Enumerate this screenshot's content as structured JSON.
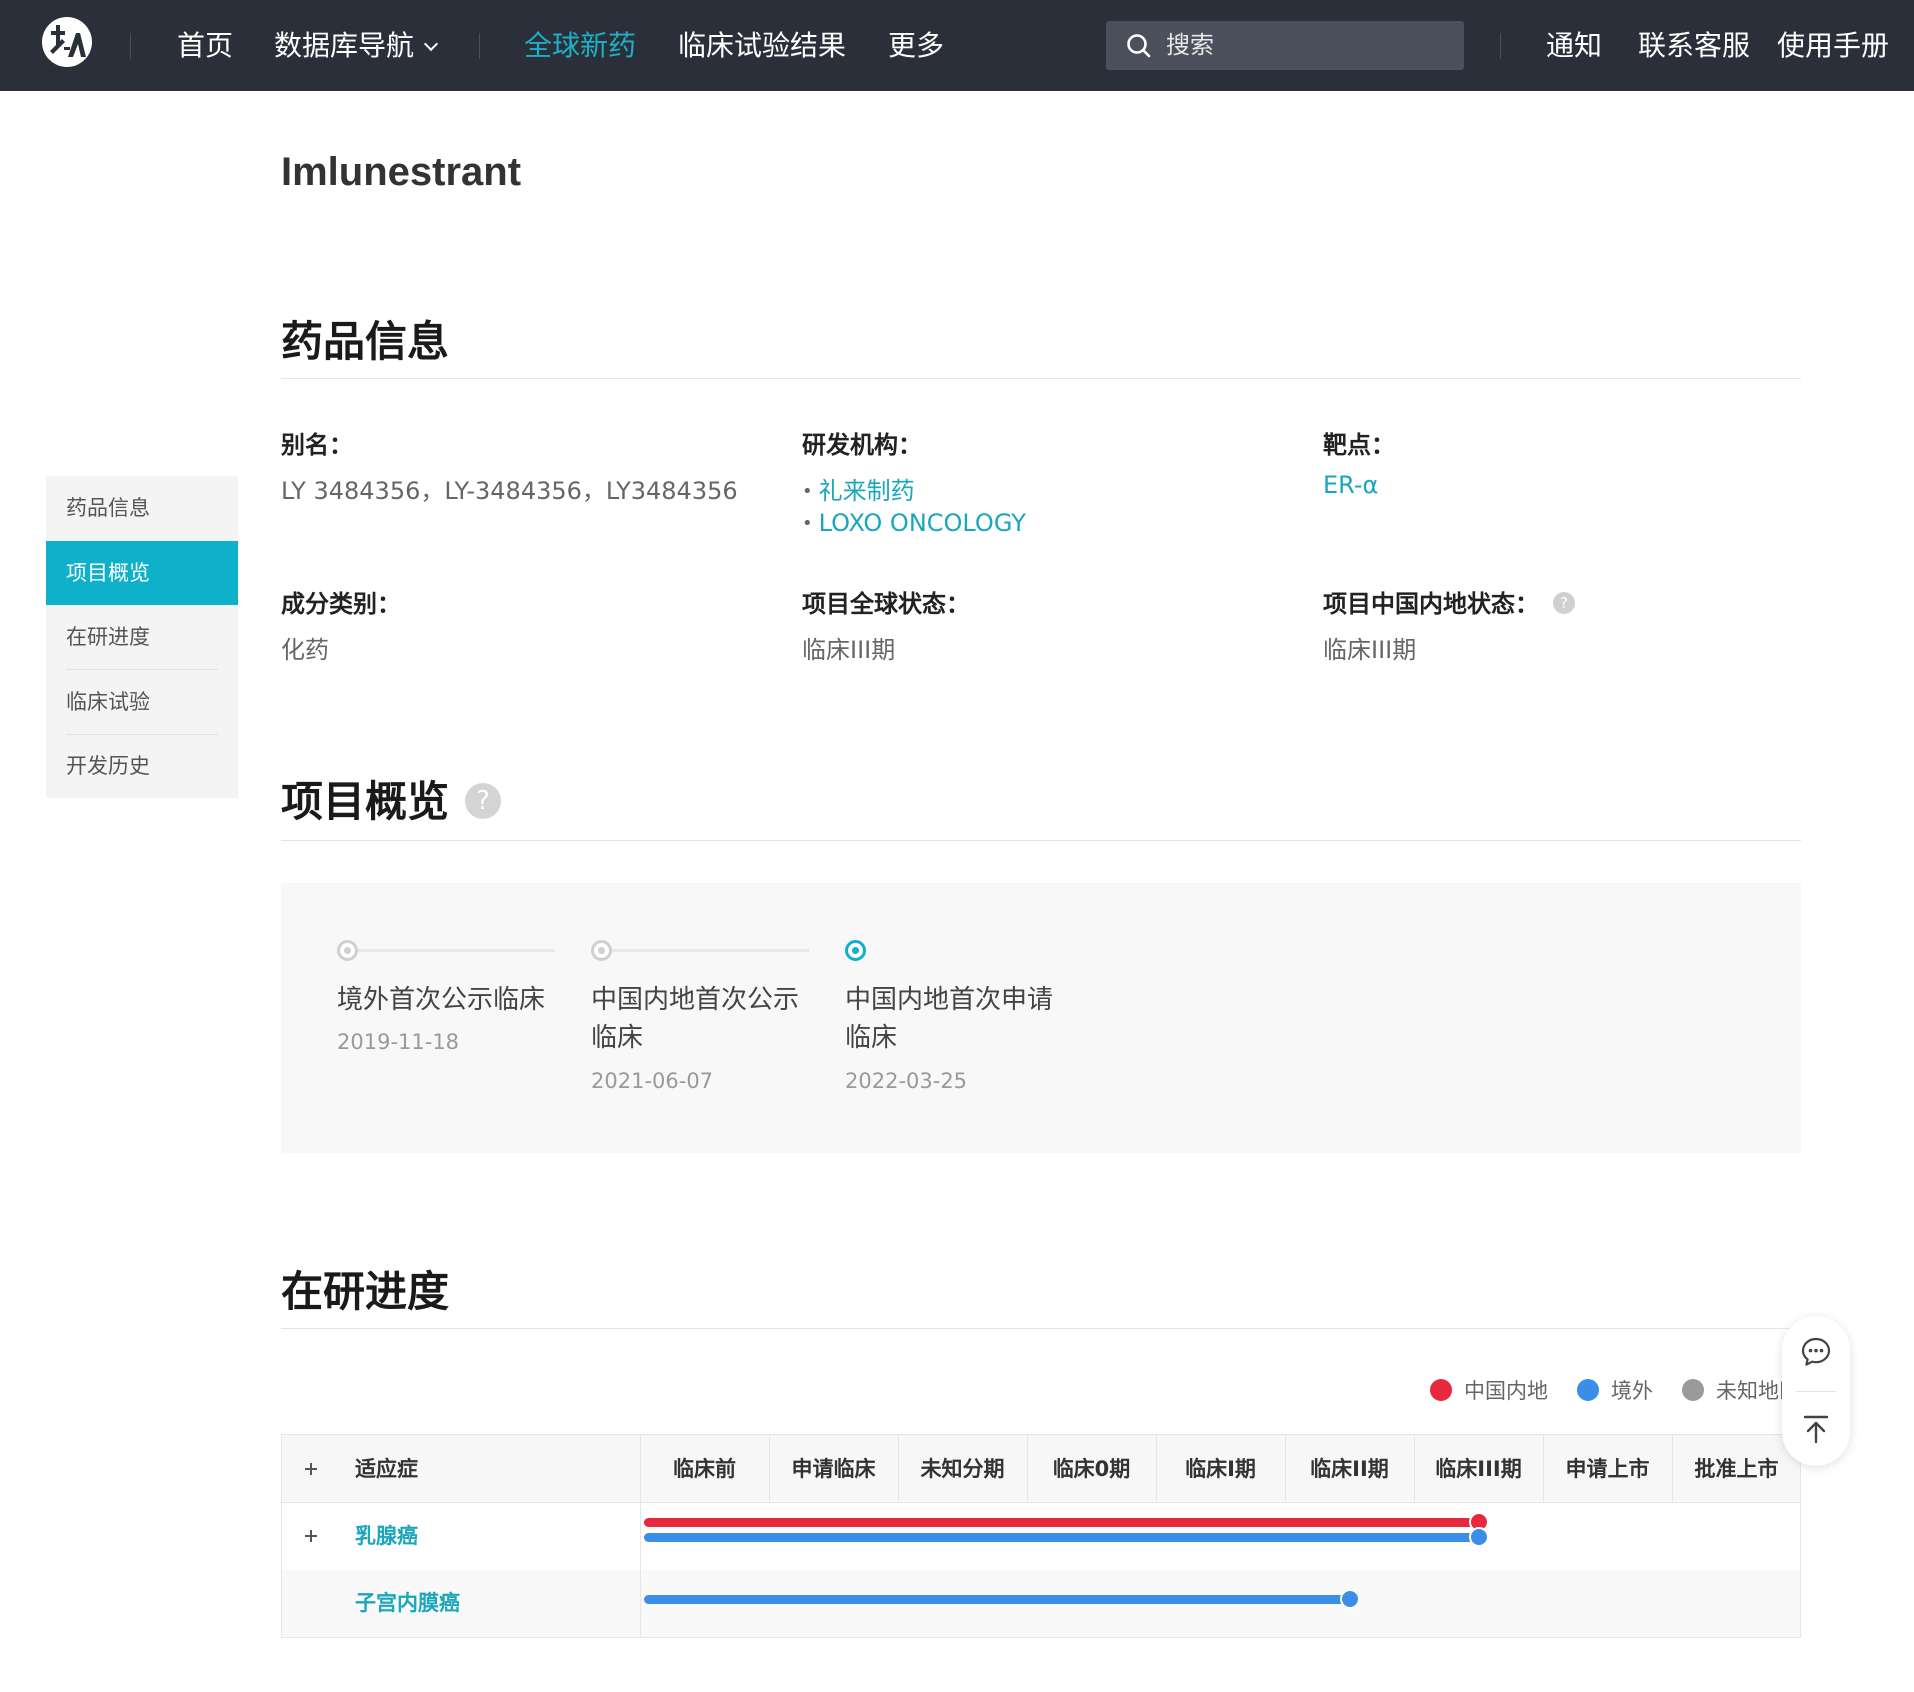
{
  "nav": {
    "home": "首页",
    "db_nav": "数据库导航",
    "global_new_drugs": "全球新药",
    "clinical_results": "临床试验结果",
    "more": "更多",
    "search_placeholder": "搜索",
    "notice": "通知",
    "support": "联系客服",
    "manual": "使用手册"
  },
  "drug": {
    "title": "Imlunestrant"
  },
  "sidebar": {
    "items": [
      {
        "label": "药品信息",
        "active": false
      },
      {
        "label": "项目概览",
        "active": true
      },
      {
        "label": "在研进度",
        "active": false
      },
      {
        "label": "临床试验",
        "active": false
      },
      {
        "label": "开发历史",
        "active": false
      }
    ]
  },
  "drug_info": {
    "heading": "药品信息",
    "alias_label": "别名：",
    "alias_value": "LY 3484356，LY-3484356，LY3484356",
    "org_label": "研发机构：",
    "orgs": [
      "礼来制药",
      "LOXO ONCOLOGY"
    ],
    "target_label": "靶点：",
    "target_value": "ER-α",
    "category_label": "成分类别：",
    "category_value": "化药",
    "global_status_label": "项目全球状态：",
    "global_status_value": "临床III期",
    "china_status_label": "项目中国内地状态：",
    "china_status_value": "临床III期",
    "help_glyph": "?"
  },
  "overview": {
    "heading": "项目概览",
    "milestones": [
      {
        "name": "境外首次公示临床",
        "date": "2019-11-18",
        "current": false
      },
      {
        "name": "中国内地首次公示临床",
        "date": "2021-06-07",
        "current": false
      },
      {
        "name": "中国内地首次申请临床",
        "date": "2022-03-25",
        "current": true
      }
    ]
  },
  "progress": {
    "heading": "在研进度",
    "legend": [
      {
        "label": "中国内地",
        "color": "#e8283c",
        "icon": "china-flag-icon"
      },
      {
        "label": "境外",
        "color": "#3b8ee8",
        "icon": "globe-icon"
      },
      {
        "label": "未知地区",
        "color": "#9a9a9a",
        "icon": "globe-gray-icon"
      }
    ],
    "indication_header": "适应症",
    "phases": [
      "临床前",
      "申请临床",
      "未知分期",
      "临床0期",
      "临床I期",
      "临床II期",
      "临床III期",
      "申请上市",
      "批准上市"
    ],
    "rows": [
      {
        "indication": "乳腺癌",
        "expandable": true,
        "bars": [
          {
            "region": "中国内地",
            "color": "#e8283c",
            "reached_phase": "临床III期"
          },
          {
            "region": "境外",
            "color": "#3b8ee8",
            "reached_phase": "临床III期"
          }
        ]
      },
      {
        "indication": "子宫内膜癌",
        "expandable": false,
        "bars": [
          {
            "region": "境外",
            "color": "#3b8ee8",
            "reached_phase": "临床II期"
          }
        ]
      }
    ]
  },
  "colors": {
    "accent": "#0fb0c9",
    "nav_bg": "#2b2f3a",
    "link": "#1aa7bd"
  }
}
